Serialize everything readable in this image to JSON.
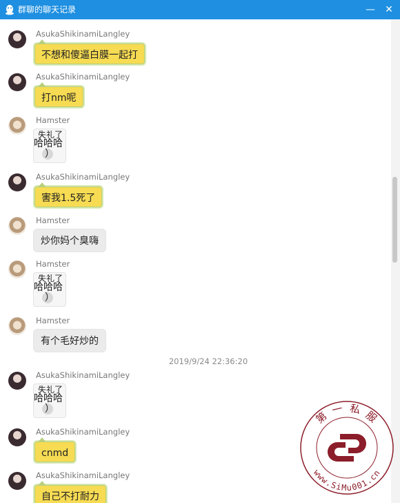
{
  "window": {
    "title": "群聊的聊天记录",
    "minimize_glyph": "—",
    "close_glyph": "✕"
  },
  "messages": [
    {
      "sender": "AsukaShikinamiLangley",
      "type": "text",
      "style": "yellow",
      "text": "不想和傻逼白膜一起打"
    },
    {
      "sender": "AsukaShikinamiLangley",
      "type": "text",
      "style": "yellow",
      "text": "打nm呢"
    },
    {
      "sender": "Hamster",
      "type": "sticker",
      "lines": [
        "失礼了",
        "哈哈哈",
        "）"
      ]
    },
    {
      "sender": "AsukaShikinamiLangley",
      "type": "text",
      "style": "yellow",
      "text": "害我1.5死了"
    },
    {
      "sender": "Hamster",
      "type": "text",
      "style": "gray",
      "text": "炒你妈个臭嗨"
    },
    {
      "sender": "Hamster",
      "type": "sticker",
      "lines": [
        "失礼了",
        "哈哈哈",
        "）"
      ]
    },
    {
      "sender": "Hamster",
      "type": "text",
      "style": "gray",
      "text": "有个毛好炒的"
    },
    {
      "sender": "AsukaShikinamiLangley",
      "type": "sticker",
      "lines": [
        "失礼了",
        "哈哈哈",
        "）"
      ]
    },
    {
      "sender": "AsukaShikinamiLangley",
      "type": "text",
      "style": "yellow",
      "text": "cnmd"
    },
    {
      "sender": "AsukaShikinamiLangley",
      "type": "text",
      "style": "yellow",
      "text": "自己不打耐力"
    }
  ],
  "timestamp": "2019/9/24 22:36:20",
  "watermark": {
    "top_text": "第 一 私 服",
    "bottom_text": "www.SiMu001.cn"
  },
  "colors": {
    "titlebar": "#1e8fe1",
    "bubble_yellow": "#f6db53",
    "bubble_gray": "#ebebeb",
    "watermark": "#8c1d2a"
  },
  "icons": {
    "titlebar": "qq-penguin-icon"
  }
}
